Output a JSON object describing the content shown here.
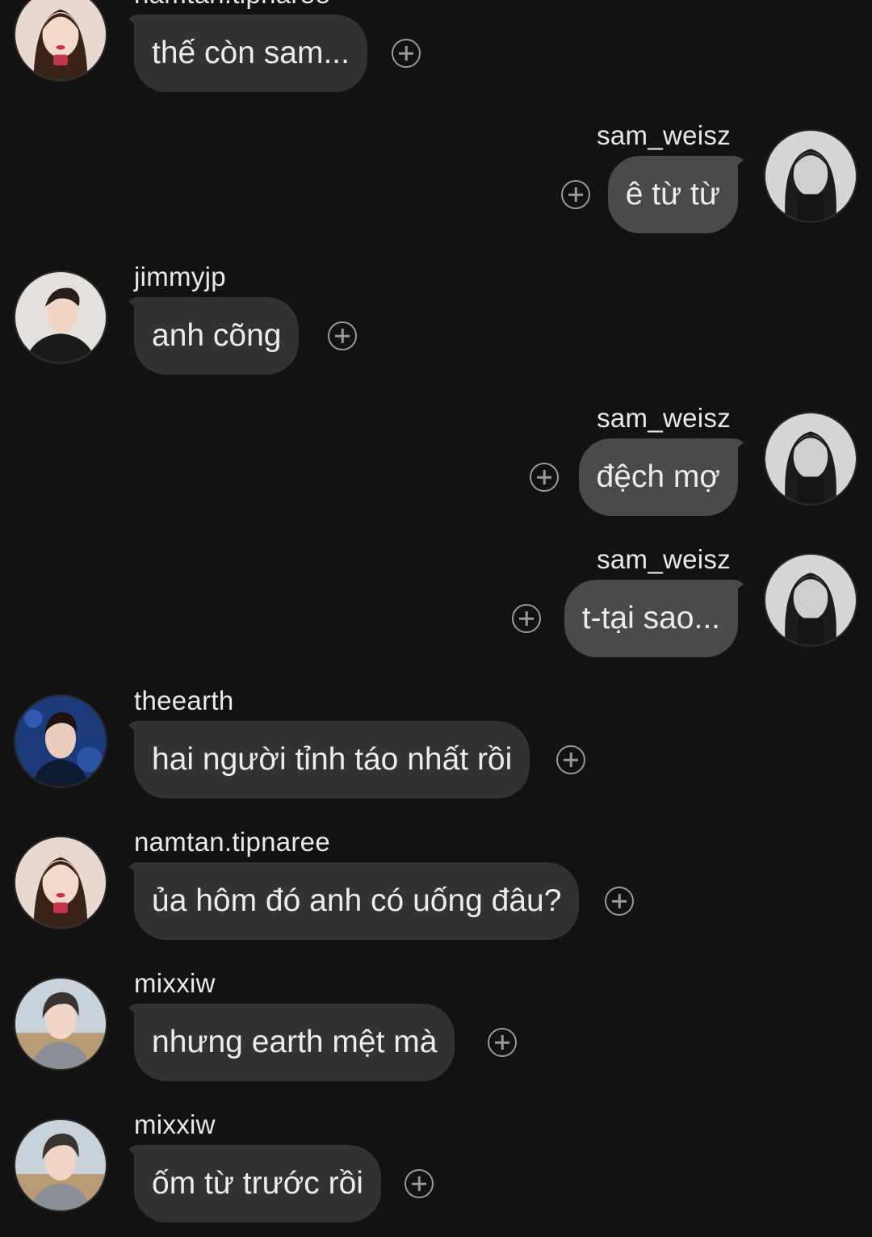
{
  "messages": [
    {
      "side": "left",
      "user": "namtan.tipnaree",
      "text": "thế còn sam...",
      "avatar": "female-portrait-icon"
    },
    {
      "side": "right",
      "user": "sam_weisz",
      "text": "ê từ từ",
      "avatar": "female-bw-portrait-icon"
    },
    {
      "side": "left",
      "user": "jimmyjp",
      "text": "anh cõng",
      "avatar": "male-portrait-icon"
    },
    {
      "side": "right",
      "user": "sam_weisz",
      "text": "đệch mợ",
      "avatar": "female-bw-portrait-icon"
    },
    {
      "side": "right",
      "user": "sam_weisz",
      "text": "t-tại sao...",
      "avatar": "female-bw-portrait-icon"
    },
    {
      "side": "left",
      "user": "theearth",
      "text": "hai người tỉnh táo nhất rồi",
      "avatar": "male-blue-portrait-icon"
    },
    {
      "side": "left",
      "user": "namtan.tipnaree",
      "text": "ủa hôm đó anh có uống đâu?",
      "avatar": "female-portrait-icon"
    },
    {
      "side": "left",
      "user": "mixxiw",
      "text": "nhưng earth mệt mà",
      "avatar": "male-outdoor-portrait-icon"
    },
    {
      "side": "left",
      "user": "mixxiw",
      "text": "ốm từ trước rồi",
      "avatar": "male-outdoor-portrait-icon"
    }
  ],
  "colors": {
    "background": "#121212",
    "bubble_left": "#323232",
    "bubble_right": "#4a4a4a",
    "react_icon": "#9a9a9a"
  }
}
